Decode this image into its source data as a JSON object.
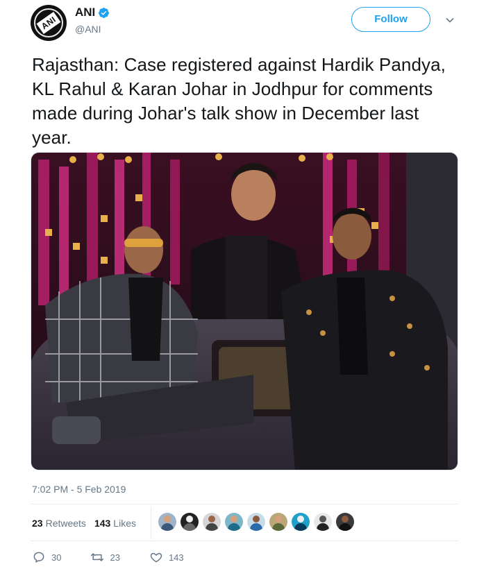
{
  "author": {
    "display_name": "ANI",
    "handle": "@ANI",
    "avatar_text": "ANI",
    "verified": true
  },
  "follow_button": {
    "label": "Follow"
  },
  "tweet": {
    "text": "Rajasthan: Case registered against Hardik Pandya, KL Rahul & Karan Johar in Jodhpur for comments made during Johar's talk show in December last year.",
    "timestamp": "7:02 PM - 5 Feb 2019"
  },
  "stats": {
    "retweets_count": "23",
    "retweets_label": "Retweets",
    "likes_count": "143",
    "likes_label": "Likes"
  },
  "actions": {
    "reply_count": "30",
    "retweet_count": "23",
    "like_count": "143"
  },
  "colors": {
    "accent": "#1da1f2",
    "text": "#14171a",
    "muted": "#657786",
    "border": "#e6ecf0"
  }
}
